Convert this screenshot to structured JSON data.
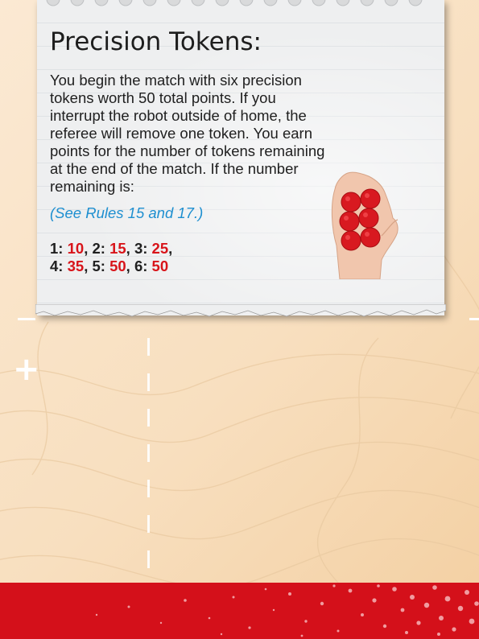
{
  "card": {
    "title": "Precision Tokens:",
    "description": "You begin the match with six precision tokens worth 50 total points. If you interrupt the robot outside of home, the referee will remove one token. You earn points for the number of tokens remaining at the end of the match. If the number remaining is:",
    "rule_reference": "(See Rules 15 and 17.)",
    "scores": [
      {
        "count": "1",
        "points": "10"
      },
      {
        "count": "2",
        "points": "15"
      },
      {
        "count": "3",
        "points": "25"
      },
      {
        "count": "4",
        "points": "35"
      },
      {
        "count": "5",
        "points": "50"
      },
      {
        "count": "6",
        "points": "50"
      }
    ]
  },
  "colors": {
    "background": "#f8dfbf",
    "paper": "#eeeff0",
    "accent_red": "#d8141a",
    "link_blue": "#1e8fd0",
    "footer_red": "#d4101a"
  },
  "icons": [
    "hand-holding-tokens-image",
    "plus-mark-icon"
  ]
}
